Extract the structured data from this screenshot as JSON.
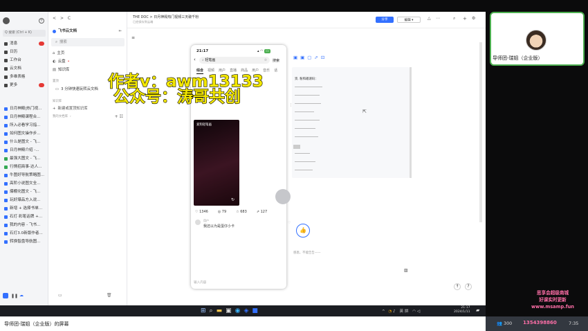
{
  "left_sidebar": {
    "search_label": "Q 搜索 (Ctrl + K)",
    "items": [
      {
        "label": "消息",
        "badge": true
      },
      {
        "label": "日历"
      },
      {
        "label": "工作台"
      },
      {
        "label": "云文档"
      },
      {
        "label": "多维表格"
      },
      {
        "label": "更多",
        "badge": true
      }
    ],
    "docs": [
      "日月神殿|热门视...",
      "日月神殿课程合...",
      "所入必看学习指...",
      "如何图文操作步...",
      "什么是图文 - 飞...",
      "日月神殿介绍 -...",
      "最强大图文 - 飞...",
      "行情招商事-达人...",
      "牛图好导航策略图...",
      "高阶小说图文全...",
      "爆棚化图文 - 飞...",
      "玩好爆品方入说...",
      "新增 + 选择书单...",
      "石灯·彩笔话牌 +...",
      "我的内容 - 飞书...",
      "石灯3.0新版作者...",
      "转换智盘导航图..."
    ]
  },
  "docs_panel": {
    "title": "飞书云文档",
    "search": "搜索",
    "items": [
      "主页",
      "云盘",
      "知识库"
    ],
    "section_pinned": "置顶",
    "pinned_doc": "3 分钟快速玩转云文档",
    "section_kb": "知识库",
    "new_kb": "新建或置顶知识库",
    "section_my": "我的文档库"
  },
  "main": {
    "nav_back": "<",
    "nav_forward": ">",
    "refresh": "C",
    "breadcrumb": "THE DOC > 日月神殿热门视频三天破千粉",
    "breadcrumb_sub": "已经保存到云端",
    "share_label": "分享",
    "edit_label": "编辑",
    "heading_fragment": "资. 粉和邀请码：",
    "comment_fragment": "感恩，不能告告——"
  },
  "phone": {
    "time": "21:17",
    "search_query": "轻笔画",
    "search_btn": "搜索",
    "tabs": [
      "综合",
      "视频",
      "用户",
      "直播",
      "商品",
      "用户",
      "音乐",
      "话"
    ],
    "video_label": "爱狗轻笔画",
    "stats": {
      "likes": "1346",
      "comments": "79",
      "stars": "683",
      "shares": "127"
    },
    "comment_text": "我还以为是蛋仔小卡",
    "comment_user": "用户",
    "input_placeholder": "输入内容"
  },
  "watermark": {
    "line1": "作者v：awm13133",
    "line2": "公众号：涛哥共创"
  },
  "taskbar": {
    "ime": "英 拼",
    "time": "21:17",
    "date": "2024/1/11"
  },
  "side_panel": {
    "presenter": "导师团-瑞姐（企业版）"
  },
  "caption": {
    "screen_label": "导师团-瑞姐（企业版）的屏幕"
  },
  "cam": {
    "viewers": "300",
    "stamp_lines": [
      "思享会超级商城",
      "好课实时更新",
      "www.msamp.fun",
      "1354398860"
    ],
    "time_fragment": "7:35"
  },
  "colors": {
    "accent": "#3370ff",
    "badge": "#e53935",
    "watermark_fill": "#f2e600",
    "stamp_pink": "#ff6fa8",
    "presenter_border": "#4caf50"
  }
}
